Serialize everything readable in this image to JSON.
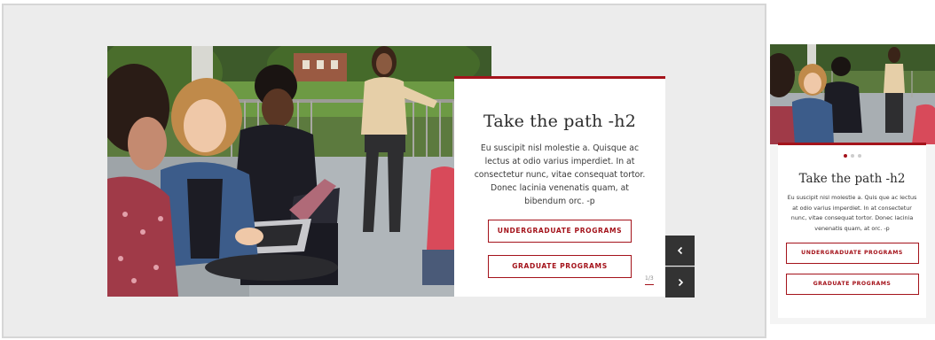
{
  "desktop": {
    "title": "Take the path -h2",
    "body": "Eu suscipit nisl molestie a. Quisque ac lectus at odio varius imperdiet. In at consectetur nunc, vitae consequat tortor. Donec lacinia venenatis quam, at bibendum orc. -p",
    "cta_primary": "UNDERGRADUATE PROGRAMS",
    "cta_secondary": "GRADUATE PROGRAMS",
    "slide_counter": "1/3",
    "prev_icon": "chevron-left-icon",
    "next_icon": "chevron-right-icon"
  },
  "mobile": {
    "title": "Take the path -h2",
    "body": "Eu suscipit nisl molestie a. Quis que ac lectus at odio varius imperdiet. In at consectetur nunc, vitae consequat tortor. Donec lacinia venenatis quam, at orc. -p",
    "cta_primary": "UNDERGRADUATE PROGRAMS",
    "cta_secondary": "GRADUATE PROGRAMS",
    "active_slide": 1,
    "total_slides": 3
  },
  "colors": {
    "accent": "#a4131b",
    "nav_button": "#333333",
    "frame_bg": "#ececec"
  }
}
